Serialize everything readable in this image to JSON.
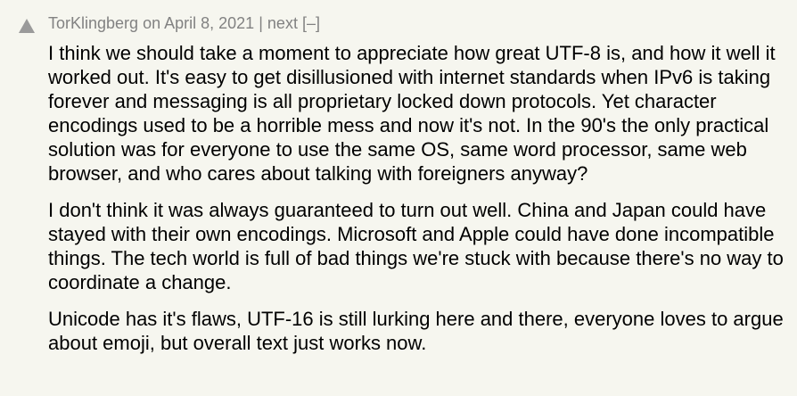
{
  "comment": {
    "author": "TorKlingberg",
    "on_word": "on",
    "date": "April 8, 2021",
    "separator": "|",
    "next_label": "next",
    "toggle_label": "[–]",
    "paragraphs": [
      "I think we should take a moment to appreciate how great UTF-8 is, and how it well it worked out. It's easy to get disillusioned with internet standards when IPv6 is taking forever and messaging is all proprietary locked down protocols. Yet character encodings used to be a horrible mess and now it's not. In the 90's the only practical solution was for everyone to use the same OS, same word processor, same web browser, and who cares about talking with foreigners anyway?",
      "I don't think it was always guaranteed to turn out well. China and Japan could have stayed with their own encodings. Microsoft and Apple could have done incompatible things. The tech world is full of bad things we're stuck with because there's no way to coordinate a change.",
      "Unicode has it's flaws, UTF-16 is still lurking here and there, everyone loves to argue about emoji, but overall text just works now."
    ]
  },
  "icons": {
    "upvote": "upvote-arrow-icon"
  },
  "colors": {
    "background": "#f6f6ef",
    "meta_text": "#828282",
    "vote_arrow": "#9a9a9a",
    "body_text": "#000000"
  }
}
